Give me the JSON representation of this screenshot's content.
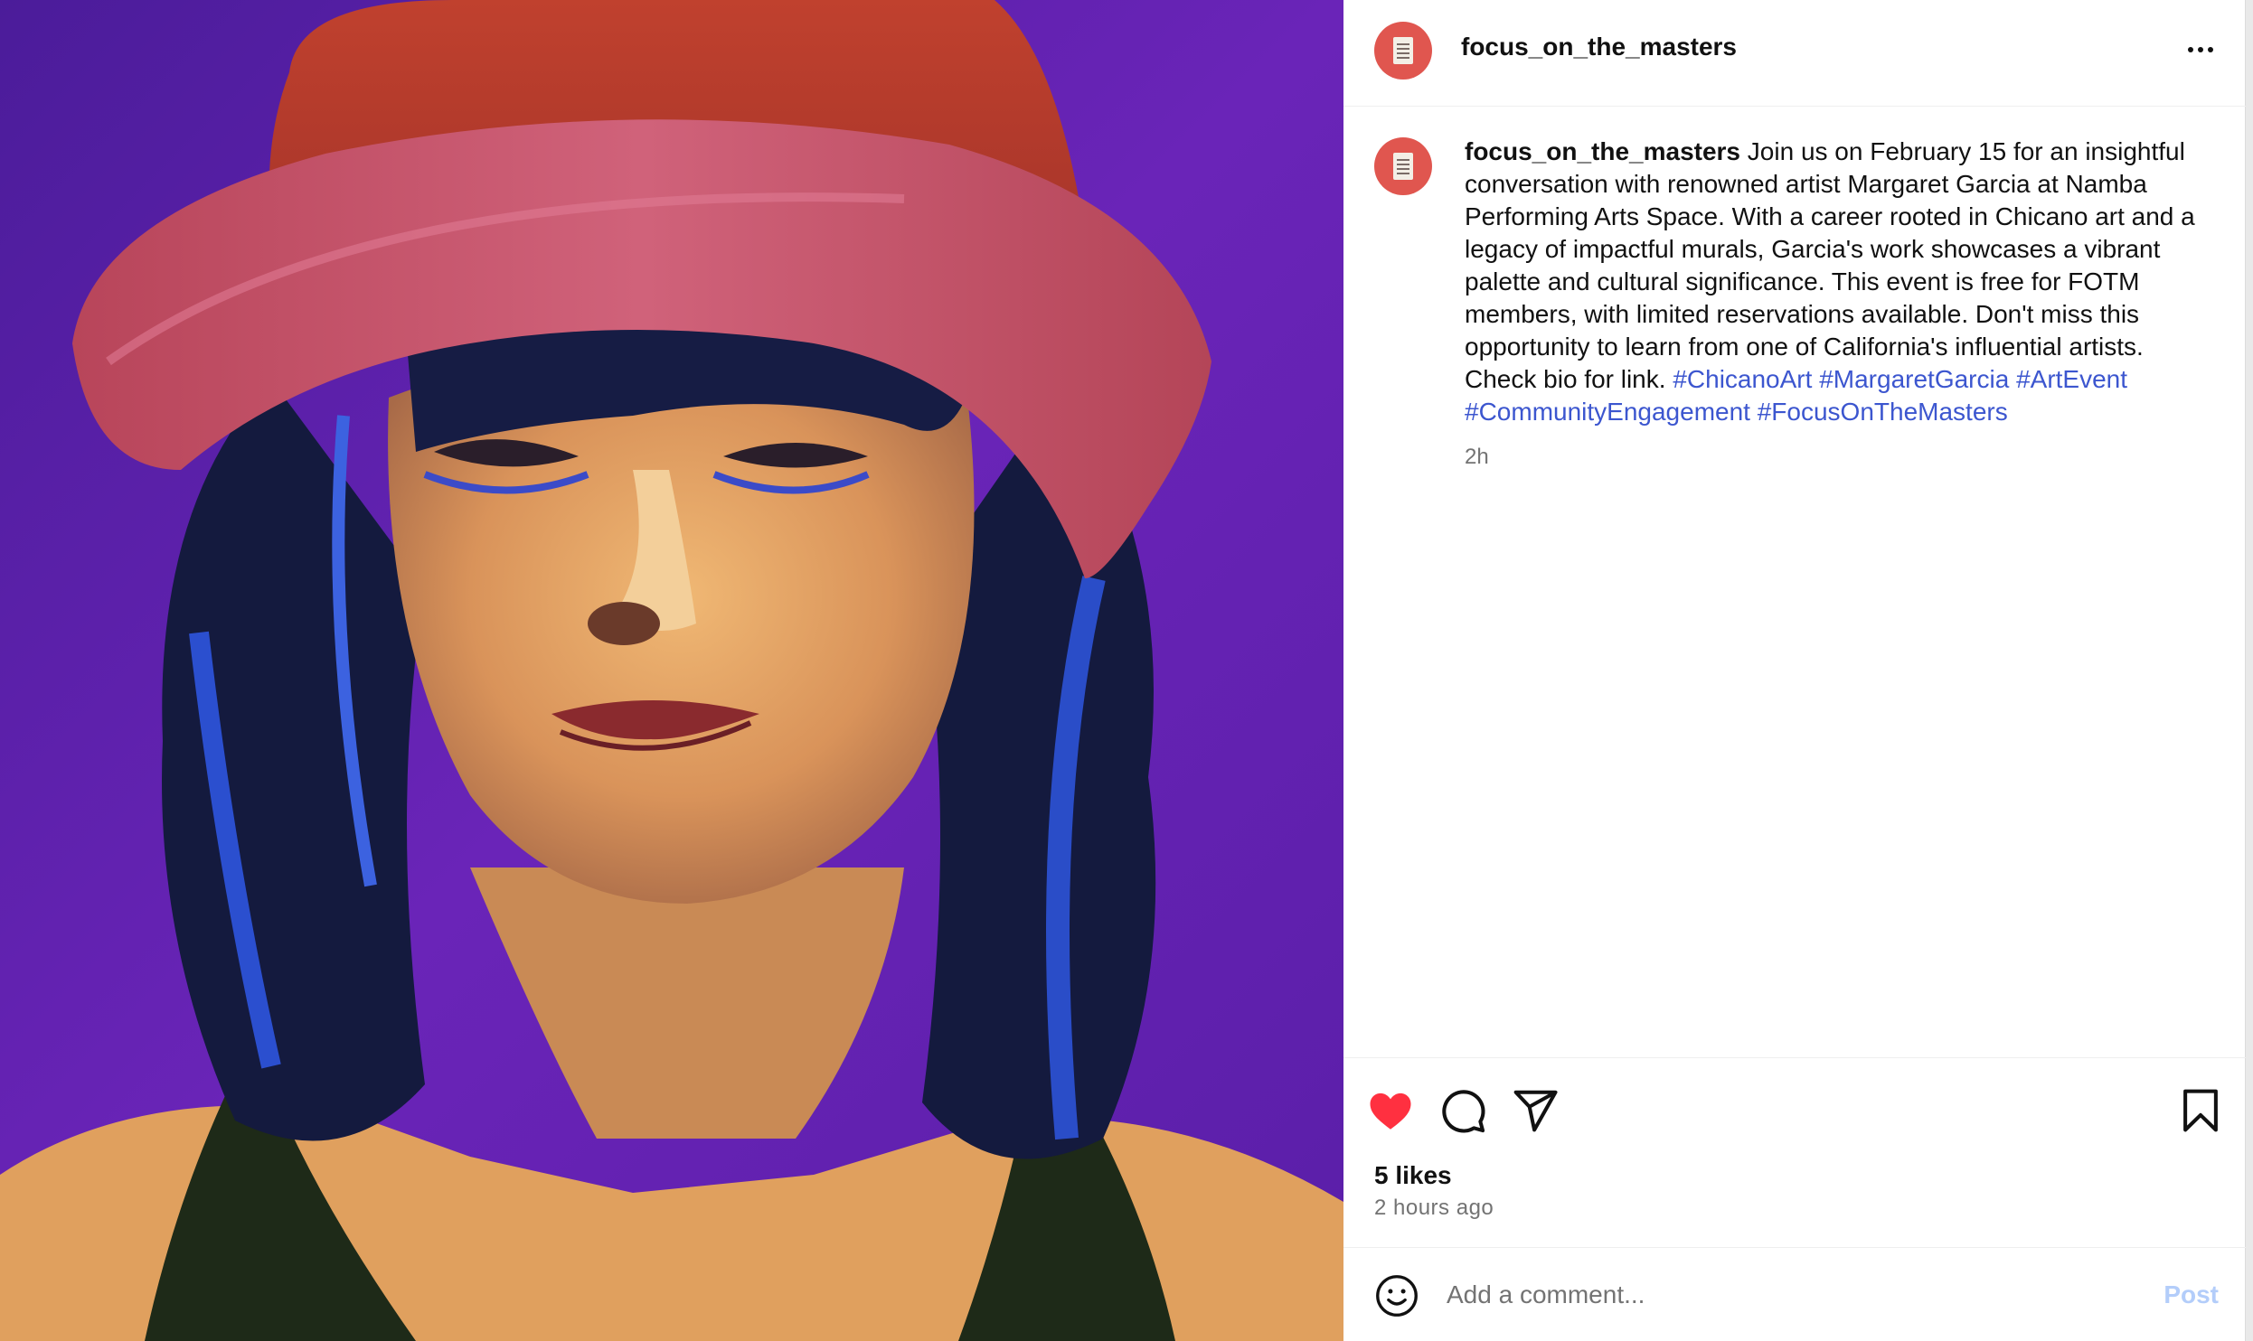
{
  "post": {
    "username": "focus_on_the_masters",
    "caption": {
      "username": "focus_on_the_masters",
      "text": " Join us on February 15 for an insightful conversation with renowned artist Margaret Garcia at Namba Performing Arts Space. With a career rooted in Chicano art and a legacy of impactful murals, Garcia's work showcases a vibrant palette and cultural significance. This event is free for FOTM members, with limited reservations available. Don't miss this opportunity to learn from one of California's influential artists. Check bio for link. ",
      "hashtags": [
        "#ChicanoArt",
        "#MargaretGarcia",
        "#ArtEvent",
        "#CommunityEngagement",
        "#FocusOnTheMasters"
      ],
      "time": "2h"
    },
    "likes": "5 likes",
    "posted_ago": "2 hours ago",
    "liked": true
  },
  "comment": {
    "placeholder": "Add a comment...",
    "post_label": "Post"
  },
  "icons": {
    "like": "heart-filled-icon",
    "comment": "comment-bubble-icon",
    "share": "paper-plane-icon",
    "save": "bookmark-icon",
    "emoji": "smiley-icon",
    "more": "more-options-icon"
  },
  "colors": {
    "like_red": "#ff3040",
    "hashtag_blue": "#3c56cf",
    "post_disabled": "#b3cdfa",
    "avatar_red": "#e0564f"
  }
}
